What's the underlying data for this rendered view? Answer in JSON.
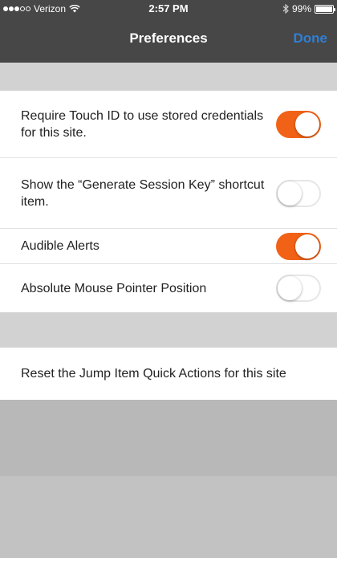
{
  "status_bar": {
    "carrier": "Verizon",
    "time": "2:57 PM",
    "battery": "99%",
    "battery_level": 0.99,
    "signal_bars_filled": 3,
    "signal_bars_total": 5
  },
  "nav": {
    "title": "Preferences",
    "done_label": "Done"
  },
  "settings": [
    {
      "label": "Require Touch ID to use stored credentials for this site.",
      "on": true
    },
    {
      "label": "Show the “Generate Session Key” shortcut item.",
      "on": false
    },
    {
      "label": "Audible Alerts",
      "on": true
    },
    {
      "label": "Absolute Mouse Pointer Position",
      "on": false
    }
  ],
  "reset": {
    "label": "Reset the Jump Item Quick Actions for this site"
  },
  "colors": {
    "accent_toggle": "#f26216",
    "done_blue": "#2f7fd5",
    "header_bg": "#474747"
  }
}
